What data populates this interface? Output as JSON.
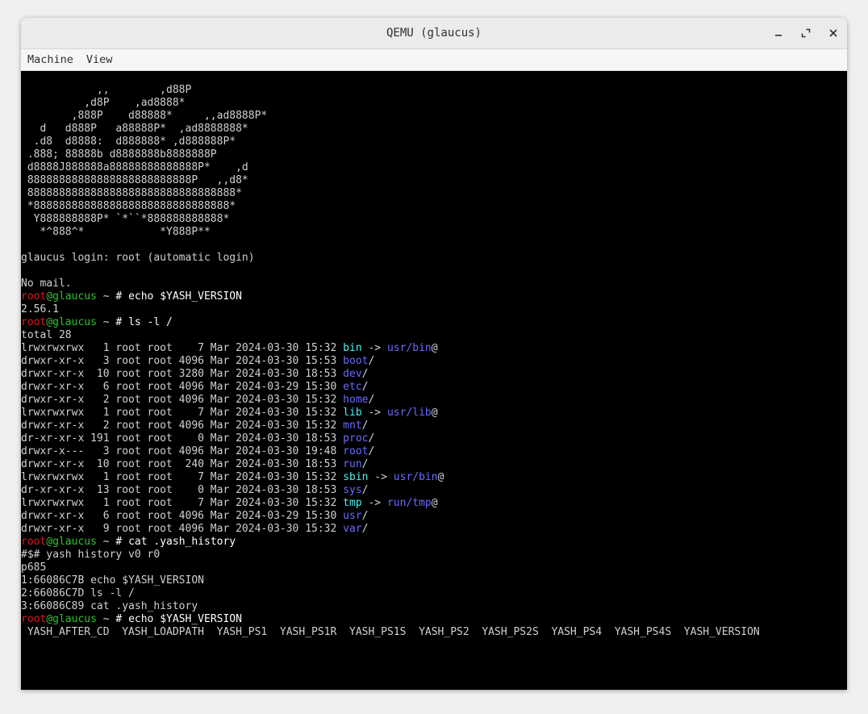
{
  "window": {
    "title": "QEMU (glaucus)"
  },
  "menu": {
    "items": [
      "Machine",
      "View"
    ]
  },
  "icons": {
    "minimize": "minimize-icon",
    "maximize": "maximize-icon",
    "close": "close-icon"
  },
  "colors": {
    "user": "#d81e1e",
    "host": "#2fc22f",
    "directory": "#6a6aff",
    "symlink": "#50f0f0",
    "text": "#d0d0d0"
  },
  "terminal": {
    "lines": [
      [
        {
          "t": "            ,,        ,d88P",
          "c": "plain"
        }
      ],
      [
        {
          "t": "          ,d8P    ,ad8888*",
          "c": "plain"
        }
      ],
      [
        {
          "t": "        ,888P    d88888*     ,,ad8888P*",
          "c": "plain"
        }
      ],
      [
        {
          "t": "   d   d888P   a88888P*  ,ad8888888*",
          "c": "plain"
        }
      ],
      [
        {
          "t": "  .d8  d8888:  d888888* ,d888888P*",
          "c": "plain"
        }
      ],
      [
        {
          "t": " .888; 88888b d8888888b8888888P",
          "c": "plain"
        }
      ],
      [
        {
          "t": " d8888J888888a88888888888888P*    ,d",
          "c": "plain"
        }
      ],
      [
        {
          "t": " 88888888888888888888888888P   ,,d8*",
          "c": "plain"
        }
      ],
      [
        {
          "t": " 888888888888888888888888888888888*",
          "c": "plain"
        }
      ],
      [
        {
          "t": " *8888888888888888888888888888888*",
          "c": "plain"
        }
      ],
      [
        {
          "t": "  Y888888888P* `*``*888888888888*",
          "c": "plain"
        }
      ],
      [
        {
          "t": "   *^888^*            *Y888P**",
          "c": "plain"
        }
      ],
      [
        {
          "t": "",
          "c": "plain"
        }
      ],
      [
        {
          "t": "glaucus login: root (automatic login)",
          "c": "plain"
        }
      ],
      [
        {
          "t": "",
          "c": "plain"
        }
      ],
      [
        {
          "t": "No mail.",
          "c": "plain"
        }
      ],
      [
        {
          "t": "root",
          "c": "red"
        },
        {
          "t": "@glaucus",
          "c": "green"
        },
        {
          "t": " ~ ",
          "c": "plain"
        },
        {
          "t": "# echo $YASH_VERSION",
          "c": "white"
        }
      ],
      [
        {
          "t": "2.56.1",
          "c": "plain"
        }
      ],
      [
        {
          "t": "root",
          "c": "red"
        },
        {
          "t": "@glaucus",
          "c": "green"
        },
        {
          "t": " ~ ",
          "c": "plain"
        },
        {
          "t": "# ls -l /",
          "c": "white"
        }
      ],
      [
        {
          "t": "total 28",
          "c": "plain"
        }
      ],
      [
        {
          "t": "lrwxrwxrwx   1 root root    7 Mar 2024-03-30 15:32 ",
          "c": "plain"
        },
        {
          "t": "bin",
          "c": "cyan"
        },
        {
          "t": " -> ",
          "c": "plain"
        },
        {
          "t": "usr/bin",
          "c": "blue"
        },
        {
          "t": "@",
          "c": "plain"
        }
      ],
      [
        {
          "t": "drwxr-xr-x   3 root root 4096 Mar 2024-03-30 15:53 ",
          "c": "plain"
        },
        {
          "t": "boot",
          "c": "blue"
        },
        {
          "t": "/",
          "c": "plain"
        }
      ],
      [
        {
          "t": "drwxr-xr-x  10 root root 3280 Mar 2024-03-30 18:53 ",
          "c": "plain"
        },
        {
          "t": "dev",
          "c": "blue"
        },
        {
          "t": "/",
          "c": "plain"
        }
      ],
      [
        {
          "t": "drwxr-xr-x   6 root root 4096 Mar 2024-03-29 15:30 ",
          "c": "plain"
        },
        {
          "t": "etc",
          "c": "blue"
        },
        {
          "t": "/",
          "c": "plain"
        }
      ],
      [
        {
          "t": "drwxr-xr-x   2 root root 4096 Mar 2024-03-30 15:32 ",
          "c": "plain"
        },
        {
          "t": "home",
          "c": "blue"
        },
        {
          "t": "/",
          "c": "plain"
        }
      ],
      [
        {
          "t": "lrwxrwxrwx   1 root root    7 Mar 2024-03-30 15:32 ",
          "c": "plain"
        },
        {
          "t": "lib",
          "c": "cyan"
        },
        {
          "t": " -> ",
          "c": "plain"
        },
        {
          "t": "usr/lib",
          "c": "blue"
        },
        {
          "t": "@",
          "c": "plain"
        }
      ],
      [
        {
          "t": "drwxr-xr-x   2 root root 4096 Mar 2024-03-30 15:32 ",
          "c": "plain"
        },
        {
          "t": "mnt",
          "c": "blue"
        },
        {
          "t": "/",
          "c": "plain"
        }
      ],
      [
        {
          "t": "dr-xr-xr-x 191 root root    0 Mar 2024-03-30 18:53 ",
          "c": "plain"
        },
        {
          "t": "proc",
          "c": "blue"
        },
        {
          "t": "/",
          "c": "plain"
        }
      ],
      [
        {
          "t": "drwxr-x---   3 root root 4096 Mar 2024-03-30 19:48 ",
          "c": "plain"
        },
        {
          "t": "root",
          "c": "blue"
        },
        {
          "t": "/",
          "c": "plain"
        }
      ],
      [
        {
          "t": "drwxr-xr-x  10 root root  240 Mar 2024-03-30 18:53 ",
          "c": "plain"
        },
        {
          "t": "run",
          "c": "blue"
        },
        {
          "t": "/",
          "c": "plain"
        }
      ],
      [
        {
          "t": "lrwxrwxrwx   1 root root    7 Mar 2024-03-30 15:32 ",
          "c": "plain"
        },
        {
          "t": "sbin",
          "c": "cyan"
        },
        {
          "t": " -> ",
          "c": "plain"
        },
        {
          "t": "usr/bin",
          "c": "blue"
        },
        {
          "t": "@",
          "c": "plain"
        }
      ],
      [
        {
          "t": "dr-xr-xr-x  13 root root    0 Mar 2024-03-30 18:53 ",
          "c": "plain"
        },
        {
          "t": "sys",
          "c": "blue"
        },
        {
          "t": "/",
          "c": "plain"
        }
      ],
      [
        {
          "t": "lrwxrwxrwx   1 root root    7 Mar 2024-03-30 15:32 ",
          "c": "plain"
        },
        {
          "t": "tmp",
          "c": "cyan"
        },
        {
          "t": " -> ",
          "c": "plain"
        },
        {
          "t": "run/tmp",
          "c": "blue"
        },
        {
          "t": "@",
          "c": "plain"
        }
      ],
      [
        {
          "t": "drwxr-xr-x   6 root root 4096 Mar 2024-03-29 15:30 ",
          "c": "plain"
        },
        {
          "t": "usr",
          "c": "blue"
        },
        {
          "t": "/",
          "c": "plain"
        }
      ],
      [
        {
          "t": "drwxr-xr-x   9 root root 4096 Mar 2024-03-30 15:32 ",
          "c": "plain"
        },
        {
          "t": "var",
          "c": "blue"
        },
        {
          "t": "/",
          "c": "plain"
        }
      ],
      [
        {
          "t": "root",
          "c": "red"
        },
        {
          "t": "@glaucus",
          "c": "green"
        },
        {
          "t": " ~ ",
          "c": "plain"
        },
        {
          "t": "# cat .yash_history",
          "c": "white"
        }
      ],
      [
        {
          "t": "#$# yash history v0 r0",
          "c": "plain"
        }
      ],
      [
        {
          "t": "p685",
          "c": "plain"
        }
      ],
      [
        {
          "t": "1:66086C7B echo $YASH_VERSION",
          "c": "plain"
        }
      ],
      [
        {
          "t": "2:66086C7D ls -l /",
          "c": "plain"
        }
      ],
      [
        {
          "t": "3:66086C89 cat .yash_history",
          "c": "plain"
        }
      ],
      [
        {
          "t": "root",
          "c": "red"
        },
        {
          "t": "@glaucus",
          "c": "green"
        },
        {
          "t": " ~ ",
          "c": "plain"
        },
        {
          "t": "# echo $YASH_VERSION",
          "c": "white"
        }
      ],
      [
        {
          "t": " YASH_AFTER_CD  YASH_LOADPATH  YASH_PS1  YASH_PS1R  YASH_PS1S  YASH_PS2  YASH_PS2S  YASH_PS4  YASH_PS4S  YASH_VERSION",
          "c": "plain"
        }
      ]
    ]
  }
}
